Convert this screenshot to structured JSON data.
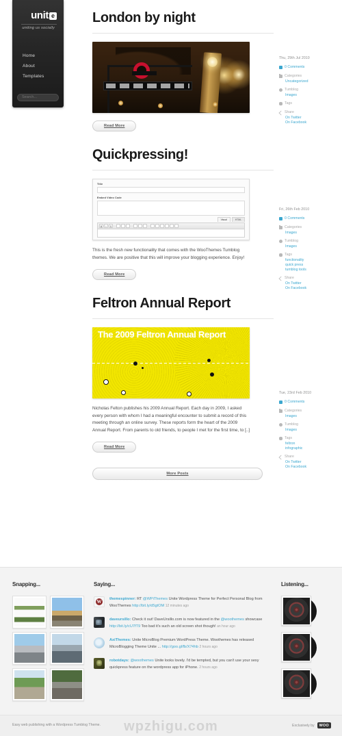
{
  "sidebar": {
    "logo_word": "unit",
    "logo_mark": "e",
    "tagline": "uniting us socially",
    "nav": [
      {
        "label": "Home"
      },
      {
        "label": "About"
      },
      {
        "label": "Templates"
      }
    ],
    "search_placeholder": "Search..."
  },
  "posts": [
    {
      "title": "London by night",
      "excerpt": "",
      "read_more": "Read More",
      "media": "london-night-photo",
      "meta": {
        "date": "Thu, 29th Jul 2010",
        "comments": "0 Comments",
        "categories_label": "Categories",
        "categories": [
          "Uncategorized"
        ],
        "tumblog_label": "Tumblog",
        "tumblog": [
          "Images"
        ],
        "tags_label": "Tags",
        "tags": [],
        "share_label": "Share",
        "share": [
          "On Twitter",
          "On Facebook"
        ]
      }
    },
    {
      "title": "Quickpressing!",
      "excerpt": "This is the fresh new functionality that comes with the WooThemes Tumblog themes. We are positive that this will improve your blogging experience. Enjoy!",
      "read_more": "Read More",
      "media": "quickpress-editor-screenshot",
      "editor": {
        "title_label": "Title",
        "embed_label": "Embed Video Code",
        "tabs": [
          "Visual",
          "HTML"
        ],
        "active_tab": "Visual"
      },
      "meta": {
        "date": "Fri, 26th Feb 2010",
        "comments": "0 Comments",
        "categories_label": "Categories",
        "categories": [
          "Images"
        ],
        "tumblog_label": "Tumblog",
        "tumblog": [
          "Images"
        ],
        "tags_label": "Tags",
        "tags": [
          "functionality",
          "quick press",
          "tumblog tools"
        ],
        "share_label": "Share",
        "share": [
          "On Twitter",
          "On Facebook"
        ]
      }
    },
    {
      "title": "Feltron Annual Report",
      "excerpt": "Nicholas Felton publishes his 2009 Annual Report. Each day in 2009, I asked every person with whom I had a meaningful encounter to submit a record of this meeting through an online survey. These reports form the heart of the 2009 Annual Report. From parents to old friends, to people I met for the first time, to [..]",
      "read_more": "Read More",
      "media": "feltron-poster",
      "poster_title": "The 2009 Feltron Annual Report",
      "meta": {
        "date": "Tue, 23rd Feb 2010",
        "comments": "0 Comments",
        "categories_label": "Categories",
        "categories": [
          "Images"
        ],
        "tumblog_label": "Tumblog",
        "tumblog": [
          "Images"
        ],
        "tags_label": "Tags",
        "tags": [
          "feltron",
          "infographic"
        ],
        "share_label": "Share",
        "share": [
          "On Twitter",
          "On Facebook"
        ]
      }
    }
  ],
  "more_posts": "More Posts",
  "footer": {
    "snapping": {
      "title": "Snapping...",
      "photo_count": 6
    },
    "saying": {
      "title": "Saying...",
      "tweets": [
        {
          "avatar": "wordpress-avatar",
          "user": "themespinner:",
          "text_1": " RT ",
          "mention": "@WPiThemes",
          "text_2": " Unite Wordpress Theme for Perfect Personal Blog from WooThemes ",
          "url": "http://bit.ly/d5gtOM",
          "time": "12 minutes ago"
        },
        {
          "avatar": "daveursillo-avatar",
          "user": "daveursillo:",
          "text_1": " Check it out! DaveUrsillo.com is now featured in the ",
          "mention": "@woothemes",
          "text_2": " showcase ",
          "url": "http://bit.ly/cU7fT9",
          "text_3": " Too bad it's such an old screen shot though!",
          "time": "an hour ago"
        },
        {
          "avatar": "axithemes-avatar",
          "user": "AxiThemes:",
          "text_1": " Unite MicroBlog Premium WordPress Theme. Woothemes has released MicroBlogging Theme Unite ... ",
          "mention": "",
          "text_2": "",
          "url": "http://goo.gl/fb/X74hb",
          "time": "2 hours ago"
        },
        {
          "avatar": "robotdays-avatar",
          "user": "robotdays:",
          "text_1": " ",
          "mention": "@woothemes",
          "text_2": " Unite looks lovely. I'd be tempted, but you can't use your sexy quickpress feature on the wordpress app for iPhone.",
          "url": "",
          "time": "2 hours ago"
        }
      ]
    },
    "listening": {
      "title": "Listening...",
      "album_count": 3
    }
  },
  "bottom_bar": {
    "left": "Easy web publishing with a Wordpress Tumblog Theme.",
    "right": "Exclusively by",
    "brand": "WOO"
  },
  "watermark": "wpzhigu.com",
  "colors": {
    "link": "#3ba7cf",
    "sidebar_bg": "#262626",
    "accent_yellow": "#f2e600"
  }
}
